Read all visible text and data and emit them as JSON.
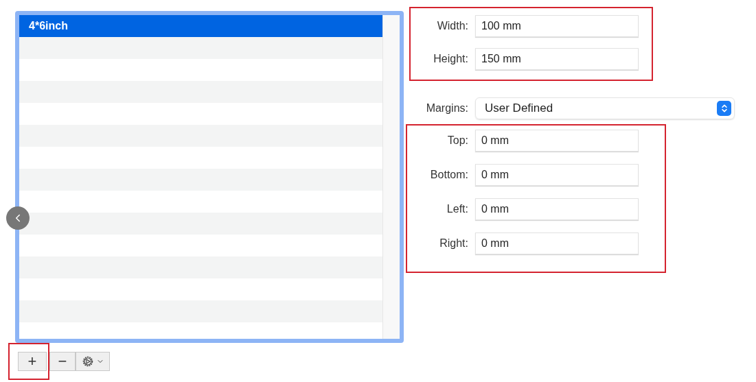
{
  "paper_list": {
    "items": [
      {
        "label": "4*6inch",
        "selected": true
      }
    ]
  },
  "list_buttons": [
    {
      "kind": "add",
      "label": "+",
      "highlighted": true
    },
    {
      "kind": "remove",
      "label": "−",
      "highlighted": false
    },
    {
      "kind": "action_menu",
      "highlighted": false
    }
  ],
  "paper_size": {
    "highlighted": true,
    "fields": [
      {
        "label": "Width:",
        "value": "100 mm"
      },
      {
        "label": "Height:",
        "value": "150 mm"
      }
    ]
  },
  "margins": {
    "label": "Margins:",
    "value": "User Defined",
    "highlighted": true,
    "fields": [
      {
        "label": "Top:",
        "value": "0 mm"
      },
      {
        "label": "Bottom:",
        "value": "0 mm"
      },
      {
        "label": "Left:",
        "value": "0 mm"
      },
      {
        "label": "Right:",
        "value": "0 mm"
      }
    ]
  }
}
